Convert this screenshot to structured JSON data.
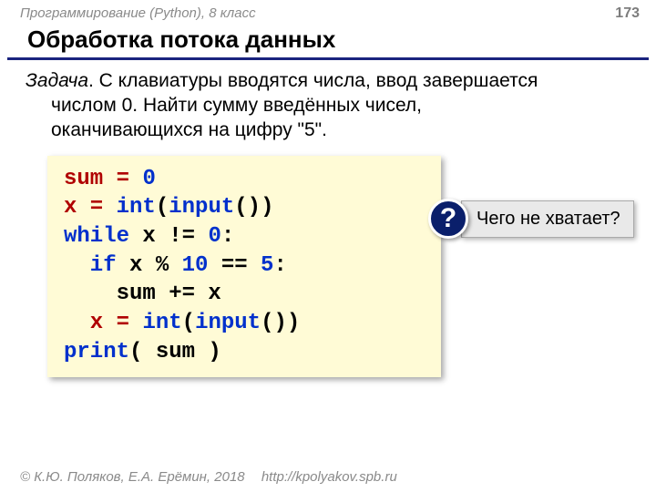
{
  "header": {
    "course": "Программирование (Python), 8 класс",
    "page_number": "173"
  },
  "title": "Обработка потока данных",
  "task": {
    "label": "Задача",
    "text_line1": ". С клавиатуры вводятся числа, ввод завершается",
    "text_line2": "числом 0. Найти сумму введённых чисел,",
    "text_line3": "оканчивающихся на цифру \"5\"."
  },
  "code": {
    "l1a": "sum",
    "l1b": " = ",
    "l1c": "0",
    "l2a": "x",
    "l2b": " = ",
    "l2c": "int",
    "l2d": "(",
    "l2e": "input",
    "l2f": "())",
    "l3a": "while",
    "l3b": " x != ",
    "l3c": "0",
    "l3d": ":",
    "l4a": "  if",
    "l4b": " x % ",
    "l4c": "10",
    "l4d": " == ",
    "l4e": "5",
    "l4f": ":",
    "l5": "    sum += x",
    "l6a": "  x",
    "l6b": " = ",
    "l6c": "int",
    "l6d": "(",
    "l6e": "input",
    "l6f": "())",
    "l7a": "print",
    "l7b": "( sum )"
  },
  "callout": {
    "badge": "?",
    "text": "Чего не хватает?"
  },
  "footer": {
    "copyright": "© К.Ю. Поляков, Е.А. Ерёмин, 2018",
    "url": "http://kpolyakov.spb.ru"
  }
}
